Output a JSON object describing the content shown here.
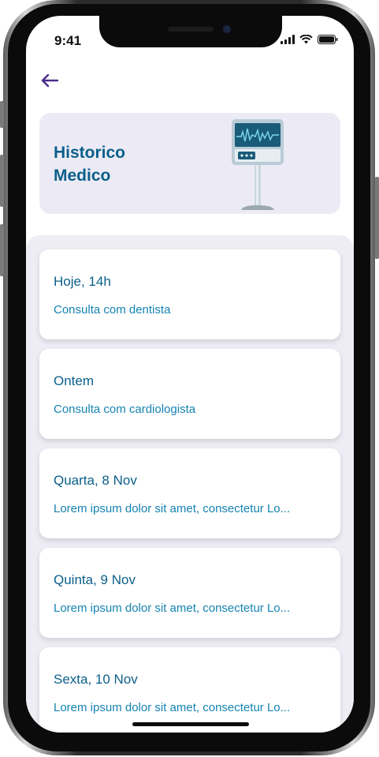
{
  "status_bar": {
    "time": "9:41"
  },
  "header": {
    "title": "Historico Medico"
  },
  "records": [
    {
      "date": "Hoje, 14h",
      "description": "Consulta com dentista"
    },
    {
      "date": "Ontem",
      "description": "Consulta com cardiologista"
    },
    {
      "date": "Quarta, 8 Nov",
      "description": "Lorem ipsum dolor sit amet, consectetur Lo..."
    },
    {
      "date": "Quinta, 9 Nov",
      "description": "Lorem ipsum dolor sit amet, consectetur Lo..."
    },
    {
      "date": "Sexta, 10 Nov",
      "description": "Lorem ipsum dolor sit amet, consectetur Lo..."
    }
  ],
  "icons": {
    "back": "arrow-left-icon",
    "illustration": "medical-monitor-icon",
    "signal": "signal-icon",
    "wifi": "wifi-icon",
    "battery": "battery-icon"
  },
  "colors": {
    "title": "#0b5f8a",
    "description": "#1583b1",
    "accent": "#4a2e8a",
    "panel": "#eeedf5"
  }
}
